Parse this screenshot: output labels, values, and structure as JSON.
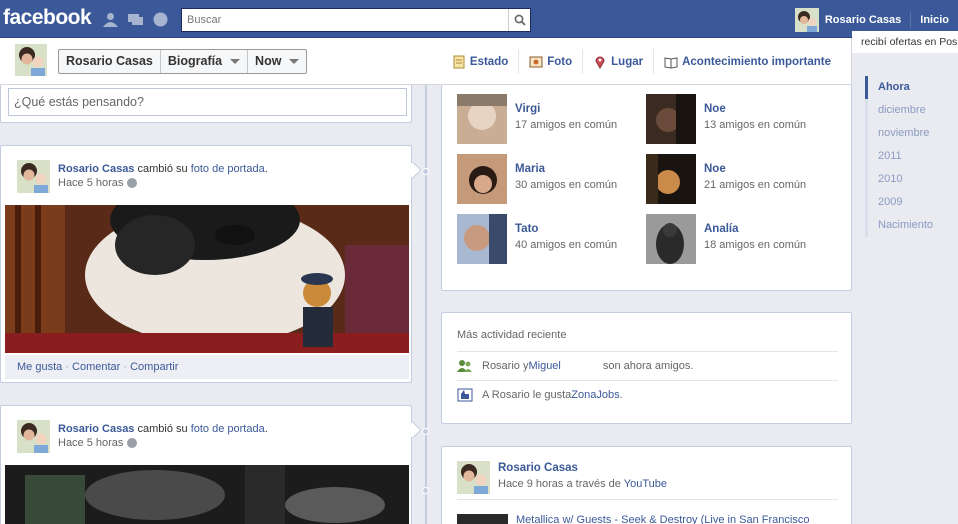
{
  "topbar": {
    "logo": "facebook",
    "search_placeholder": "Buscar",
    "user_name": "Rosario Casas",
    "home_label": "Inicio",
    "icons": [
      "friend-requests-icon",
      "messages-icon",
      "notifications-icon",
      "search-icon"
    ]
  },
  "ticker": {
    "line1": "recibí ofertas en Pos"
  },
  "timeline_bar": {
    "name": "Rosario Casas",
    "section": "Biografía",
    "period": "Now",
    "composer": [
      "Estado",
      "Foto",
      "Lugar",
      "Acontecimiento importante"
    ]
  },
  "status": {
    "placeholder": "¿Qué estás pensando?"
  },
  "posts": [
    {
      "author": "Rosario Casas",
      "verb": " cambió su ",
      "object": "foto de portada",
      "suffix": ".",
      "time": "Hace 5 horas",
      "actions": {
        "like": "Me gusta",
        "comment": "Comentar",
        "share": "Compartir",
        "sep": " · "
      }
    },
    {
      "author": "Rosario Casas",
      "verb": " cambió su ",
      "object": "foto de portada",
      "suffix": ".",
      "time": "Hace 5 horas"
    }
  ],
  "friends": [
    {
      "name": "Virgi",
      "mutual": "17 amigos en común"
    },
    {
      "name": "Noe",
      "mutual": "13 amigos en común"
    },
    {
      "name": "Maria",
      "mutual": "30 amigos en común"
    },
    {
      "name": "Noe",
      "mutual": "21 amigos en común"
    },
    {
      "name": "Tato",
      "mutual": "40 amigos en común"
    },
    {
      "name": "Analía",
      "mutual": "18 amigos en común"
    }
  ],
  "activity": {
    "title": "Más actividad reciente",
    "rows": [
      {
        "pre": "Rosario y ",
        "link": "Miguel",
        "post": "son ahora amigos."
      },
      {
        "pre": "A Rosario le gusta ",
        "link": "ZonaJobs",
        "post": "."
      }
    ]
  },
  "share": {
    "author": "Rosario Casas",
    "meta_pre": "Hace 9 horas a través de ",
    "meta_link": "YouTube",
    "video_title": "Metallica w/ Guests - Seek & Destroy (Live in San Francisco"
  },
  "scrubber": [
    "Ahora",
    "diciembre",
    "noviembre",
    "2011",
    "2010",
    "2009",
    "Nacimiento"
  ],
  "colors": {
    "brand": "#3b5998",
    "background": "#e9ebf1",
    "spine": "#c4cde0"
  }
}
